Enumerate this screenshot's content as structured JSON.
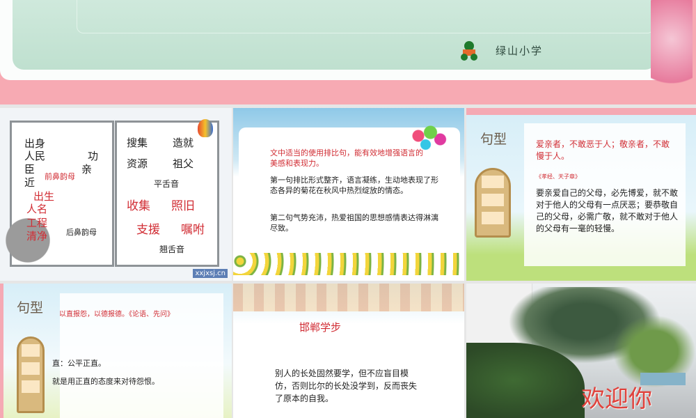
{
  "top_slide": {
    "logo_text": "绿山小学"
  },
  "slides": [
    {
      "left_page": {
        "words": [
          "出身",
          "人民",
          "臣",
          "近",
          "功",
          "亲"
        ],
        "label_front": "前鼻韵母",
        "red_words": [
          "出生",
          "人名",
          "工程",
          "清净"
        ],
        "label_back": "后鼻韵母"
      },
      "right_page": {
        "row1": [
          "搜集",
          "造就"
        ],
        "row2": [
          "资源",
          "祖父"
        ],
        "label_flat": "平舌音",
        "red_row1": [
          "收集",
          "照旧"
        ],
        "red_row2": [
          "支援",
          "嘱咐"
        ],
        "label_retroflex": "翘舌音"
      },
      "watermark": "xxjxsj.cn"
    },
    {
      "red_text": "文中适当的使用排比句，能有效地增强语言的美感和表现力。",
      "para1": "第一句排比形式整齐，语言凝练，生动地表现了形态各异的菊花在秋风中热烈绽放的情态。",
      "para2": "第二句气势充沛，热爱祖国的思想感情表达得淋漓尽致。"
    },
    {
      "badge": "句型",
      "red_text": "爱亲者，不敢恶于人；敬亲者，不敢慢于人。",
      "source": "《孝经、天子章》",
      "body": "要亲爱自己的父母，必先博爱，就不敢对于他人的父母有一点厌恶；要恭敬自己的父母，必需广敬，就不敢对于他人的父母有一毫的轻慢。"
    },
    {
      "badge": "句型",
      "red_text": "以直报怨，以德报德。《论语、先问》",
      "line1": "直：公平正直。",
      "line2": "就是用正直的态度来对待怨恨。"
    },
    {
      "title": "邯郸学步",
      "body": "别人的长处固然要学，但不应盲目模仿，否则比尔的长处没学到，反而丧失了原本的自我。"
    },
    {
      "caption": "欢迎你"
    }
  ],
  "colors": {
    "pink": "#f7aab3",
    "red_text": "#d12d34"
  }
}
